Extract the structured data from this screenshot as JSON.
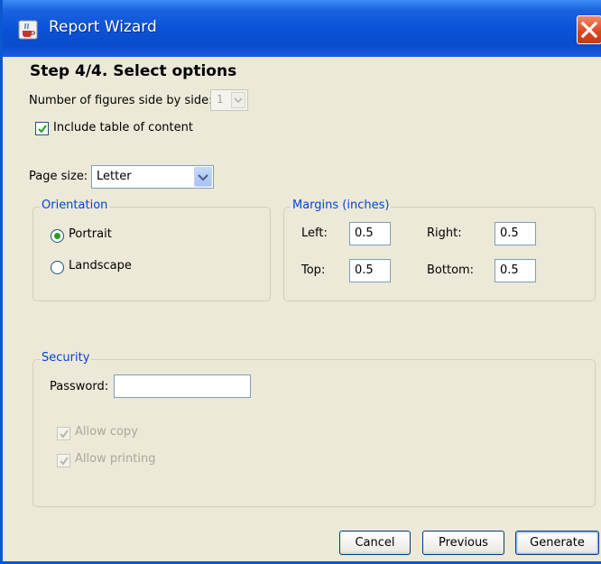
{
  "window": {
    "title": "Report Wizard",
    "icon": "java-cup-icon"
  },
  "step_title": "Step 4/4. Select options",
  "figures": {
    "label": "Number of figures side by side:",
    "value": "1"
  },
  "toc": {
    "label": "Include table of content",
    "checked": true
  },
  "page_size": {
    "label": "Page size:",
    "value": "Letter"
  },
  "orientation": {
    "title": "Orientation",
    "portrait_label": "Portrait",
    "landscape_label": "Landscape",
    "selected": "Portrait"
  },
  "margins": {
    "title": "Margins (inches)",
    "left_label": "Left:",
    "left_value": "0.5",
    "right_label": "Right:",
    "right_value": "0.5",
    "top_label": "Top:",
    "top_value": "0.5",
    "bottom_label": "Bottom:",
    "bottom_value": "0.5"
  },
  "security": {
    "title": "Security",
    "password_label": "Password:",
    "password_value": "",
    "allow_copy_label": "Allow copy",
    "allow_printing_label": "Allow printing"
  },
  "buttons": {
    "cancel": "Cancel",
    "previous": "Previous",
    "generate": "Generate"
  },
  "colors": {
    "titlebar": "#0a4ccc",
    "group_title": "#0046d5",
    "check": "#21a121",
    "close": "#d8461e"
  }
}
